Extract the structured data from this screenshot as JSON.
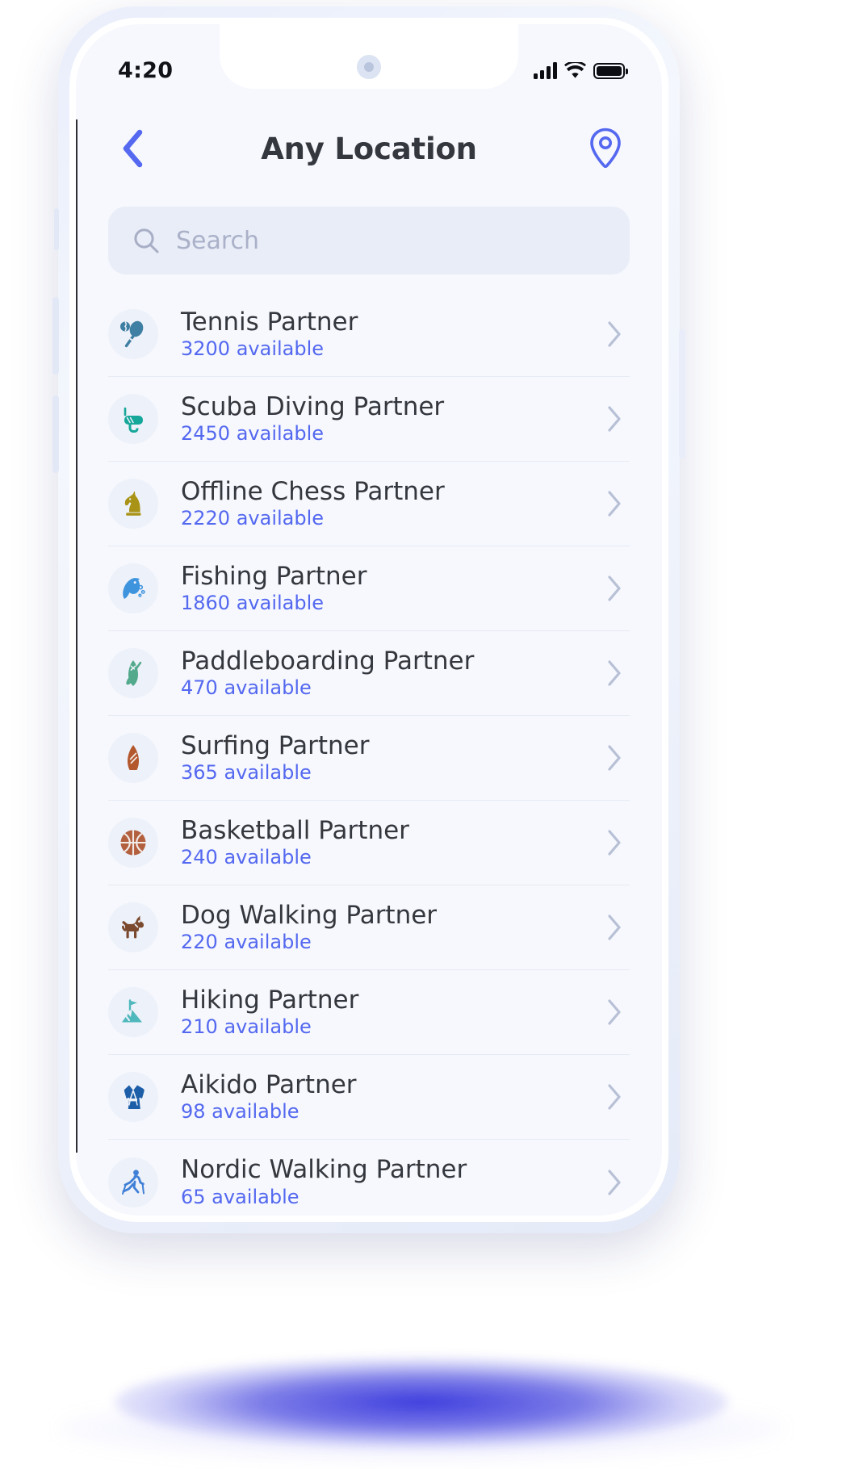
{
  "status_bar": {
    "time": "4:20",
    "icons": [
      "signal-bars-icon",
      "wifi-icon",
      "battery-icon"
    ]
  },
  "header": {
    "back_icon": "chevron-left-icon",
    "title": "Any Location",
    "location_icon": "map-pin-icon"
  },
  "search": {
    "icon": "search-icon",
    "placeholder": "Search",
    "value": ""
  },
  "colors": {
    "accent_blue": "#5468f0",
    "title_text": "#35373f",
    "screen_bg": "#f6f8fd",
    "search_bg": "#e9edf7",
    "icon_bubble": "#edf1f9",
    "divider": "#e6eaf4"
  },
  "list": {
    "chevron_icon": "chevron-right-icon",
    "items": [
      {
        "title": "Tennis Partner",
        "subtitle": "3200 available",
        "count": 3200,
        "icon": "tennis-racket-icon",
        "icon_color": "#3f7fa3"
      },
      {
        "title": "Scuba Diving Partner",
        "subtitle": "2450 available",
        "count": 2450,
        "icon": "diving-mask-icon",
        "icon_color": "#16a79b"
      },
      {
        "title": "Offline Chess Partner",
        "subtitle": "2220 available",
        "count": 2220,
        "icon": "chess-knight-icon",
        "icon_color": "#a89316"
      },
      {
        "title": "Fishing Partner",
        "subtitle": "1860 available",
        "count": 1860,
        "icon": "fish-icon",
        "icon_color": "#3f94de"
      },
      {
        "title": "Paddleboarding Partner",
        "subtitle": "470 available",
        "count": 470,
        "icon": "paddleboard-icon",
        "icon_color": "#52a98b"
      },
      {
        "title": "Surfing Partner",
        "subtitle": "365 available",
        "count": 365,
        "icon": "surfboard-icon",
        "icon_color": "#b3572d"
      },
      {
        "title": "Basketball Partner",
        "subtitle": "240 available",
        "count": 240,
        "icon": "basketball-icon",
        "icon_color": "#b3603f"
      },
      {
        "title": "Dog Walking Partner",
        "subtitle": "220 available",
        "count": 220,
        "icon": "dog-icon",
        "icon_color": "#7b4a2e"
      },
      {
        "title": "Hiking Partner",
        "subtitle": "210 available",
        "count": 210,
        "icon": "mountain-flag-icon",
        "icon_color": "#4fb8bd"
      },
      {
        "title": "Aikido Partner",
        "subtitle": "98 available",
        "count": 98,
        "icon": "martial-arts-gi-icon",
        "icon_color": "#1c5fa8"
      },
      {
        "title": "Nordic Walking Partner",
        "subtitle": "65 available",
        "count": 65,
        "icon": "nordic-walking-icon",
        "icon_color": "#3f7fd6"
      }
    ]
  }
}
